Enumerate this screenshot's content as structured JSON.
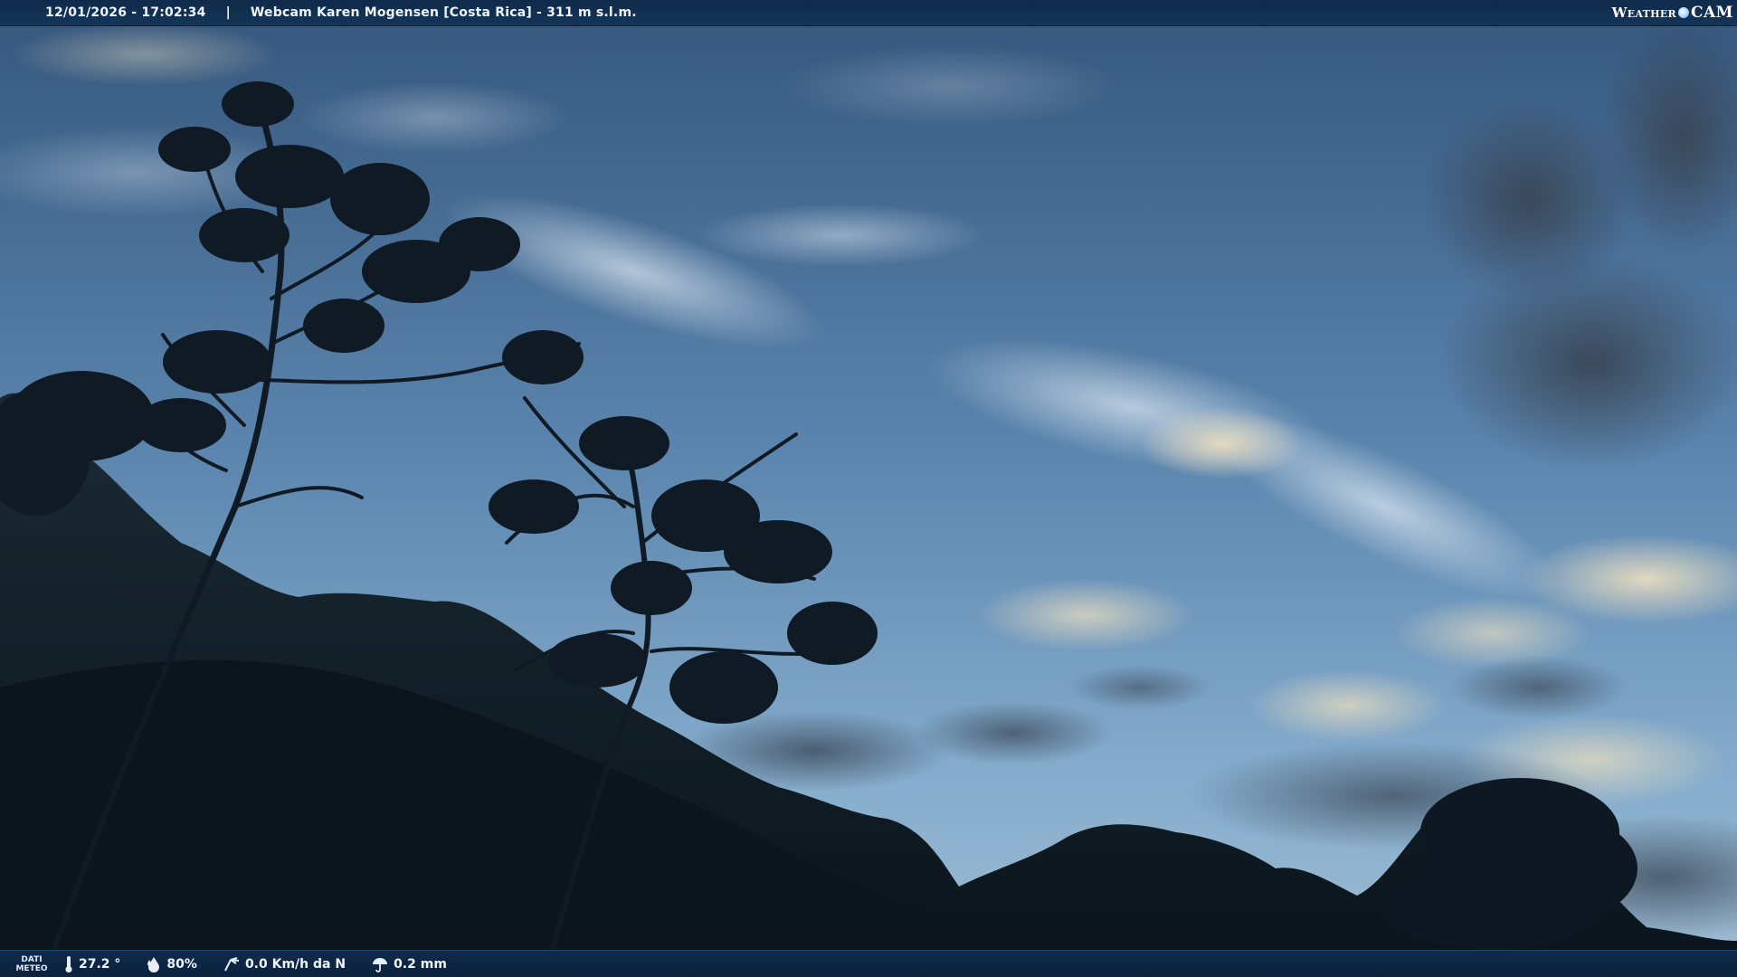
{
  "overlay": {
    "timestamp": "12/01/2026 - 17:02:34",
    "separator": "|",
    "title": "Webcam Karen Mogensen [Costa Rica]  - 311 m s.l.m.",
    "logo_word": "Weather",
    "logo_cam": "CAM"
  },
  "meteo": {
    "label_line1": "DATI",
    "label_line2": "METEO",
    "temperature": "27.2 °",
    "humidity": "80%",
    "wind": "0.0 Km/h da N",
    "rain": "0.2 mm",
    "icons": [
      "thermometer-icon",
      "humidity-icon",
      "wind-icon",
      "rain-icon"
    ]
  },
  "colors": {
    "bar_bg": "#143558",
    "sky_top": "#3d6088",
    "sky_horizon": "#8fb6d6",
    "foliage": "#0e1822"
  }
}
